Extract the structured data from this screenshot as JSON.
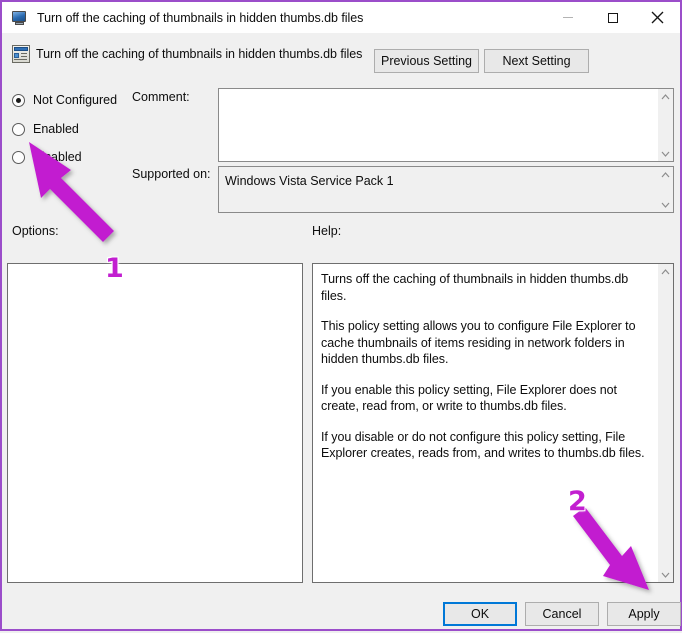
{
  "window": {
    "title": "Turn off the caching of thumbnails in hidden thumbs.db files",
    "title_icon": "computer-monitor-icon",
    "border_color": "#9b4dca",
    "titlebar_bg": "#ffffff",
    "body_bg": "#f0f0f0",
    "controls": {
      "minimize": "—",
      "maximize": "☐",
      "close": "✕"
    }
  },
  "header": {
    "icon": "group-policy-setting-icon",
    "title": "Turn off the caching of thumbnails in hidden thumbs.db files",
    "previous_button": "Previous Setting",
    "next_button": "Next Setting"
  },
  "state_options": [
    {
      "label": "Not Configured",
      "selected": true
    },
    {
      "label": "Enabled",
      "selected": false
    },
    {
      "label": "Disabled",
      "selected": false
    }
  ],
  "comment": {
    "label": "Comment:",
    "value": "",
    "placeholder": ""
  },
  "supported_on": {
    "label": "Supported on:",
    "value": "Windows Vista Service Pack 1"
  },
  "options": {
    "label": "Options:",
    "content": ""
  },
  "help": {
    "label": "Help:",
    "paragraphs": [
      "Turns off the caching of thumbnails in hidden thumbs.db files.",
      "This policy setting allows you to configure File Explorer to cache thumbnails of items residing in network folders in hidden thumbs.db files.",
      "If you enable this policy setting, File Explorer does not create, read from, or write to thumbs.db files.",
      "If you disable or do not configure this policy setting, File Explorer creates, reads from, and writes to thumbs.db files."
    ]
  },
  "footer": {
    "ok": "OK",
    "cancel": "Cancel",
    "apply": "Apply"
  },
  "annotations": {
    "accent_color": "#c21fd0",
    "markers": [
      {
        "number": "1",
        "points_to": "Enabled radio button"
      },
      {
        "number": "2",
        "points_to": "Apply button"
      }
    ]
  }
}
